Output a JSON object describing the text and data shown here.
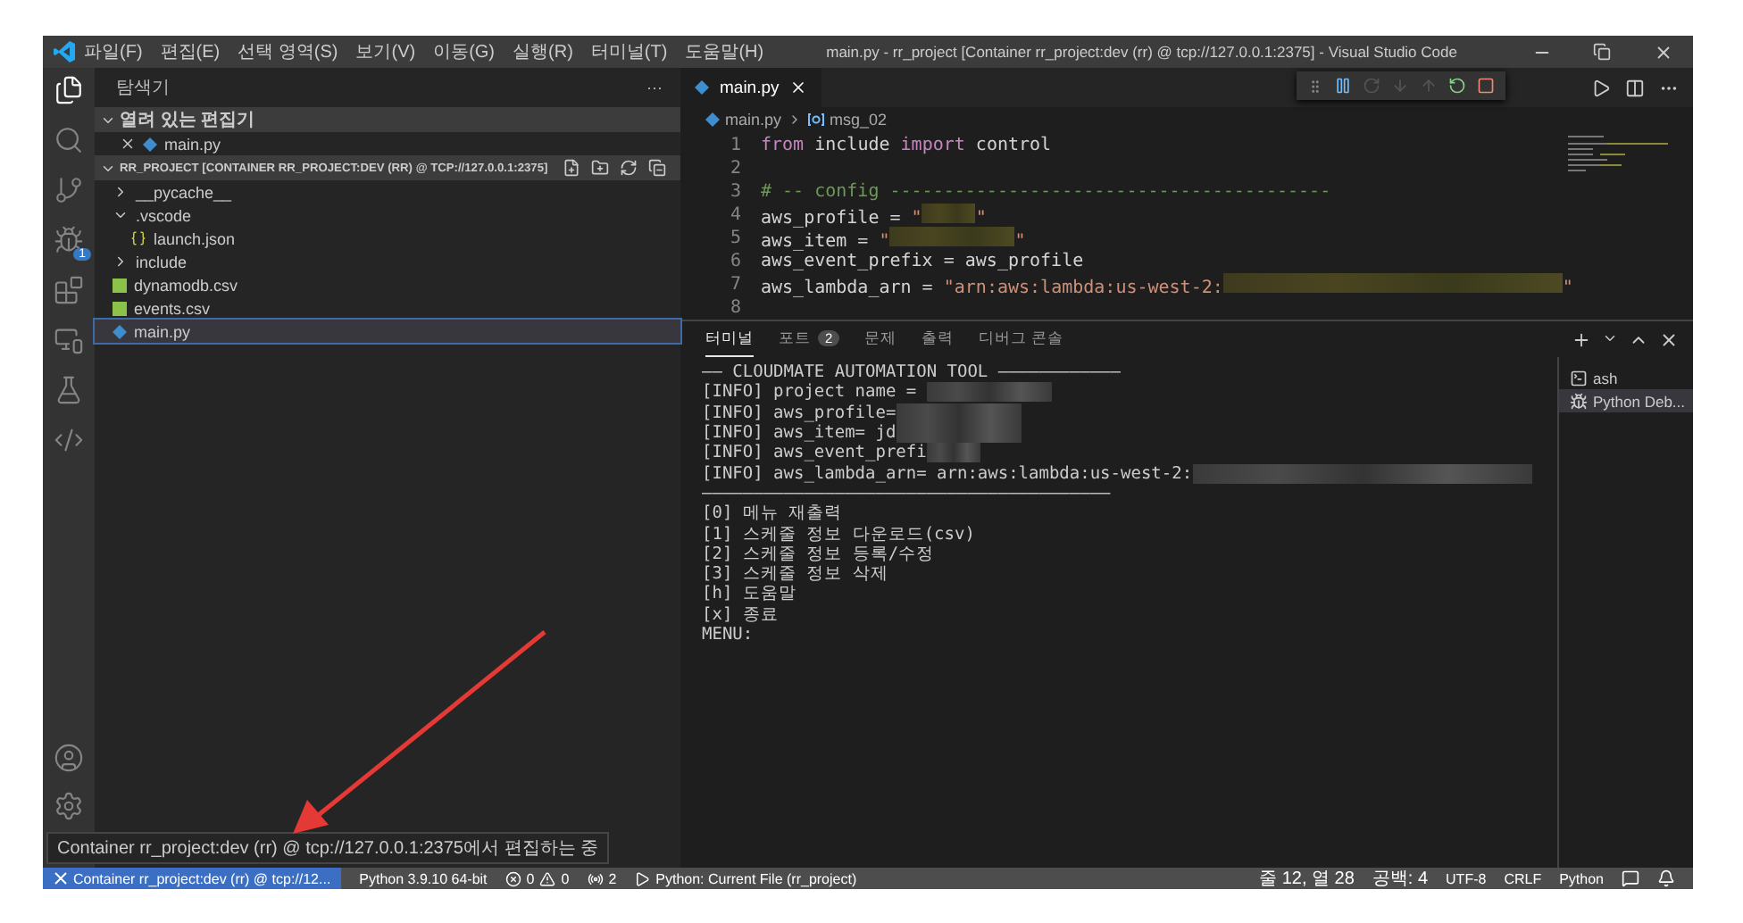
{
  "window": {
    "title": "main.py - rr_project [Container rr_project:dev (rr) @ tcp://127.0.0.1:2375] - Visual Studio Code"
  },
  "menu": [
    "파일(F)",
    "편집(E)",
    "선택 영역(S)",
    "보기(V)",
    "이동(G)",
    "실행(R)",
    "터미널(T)",
    "도움말(H)"
  ],
  "activity_bar": [
    {
      "kind": "files",
      "selected": true
    },
    {
      "kind": "search",
      "selected": false
    },
    {
      "kind": "source-control",
      "selected": false
    },
    {
      "kind": "debug",
      "selected": false,
      "badge": "1"
    },
    {
      "kind": "extensions",
      "selected": false
    },
    {
      "kind": "remote",
      "selected": false
    },
    {
      "kind": "testing",
      "selected": false
    },
    {
      "kind": "python",
      "selected": false
    }
  ],
  "sidebar": {
    "title": "탐색기",
    "more": "···",
    "open_editors": {
      "label": "열려 있는 편집기",
      "expanded": true,
      "items": [
        {
          "name": "main.py",
          "kind": "python"
        }
      ]
    },
    "project": {
      "label": "RR_PROJECT [CONTAINER RR_PROJECT:DEV (RR) @ TCP://127.0.0.1:2375]",
      "expanded": true,
      "items": [
        {
          "name": "__pycache__",
          "kind": "folder",
          "expanded": false,
          "selected": false
        },
        {
          "name": ".vscode",
          "kind": "folder",
          "expanded": true,
          "selected": false,
          "children": [
            {
              "name": "launch.json",
              "kind": "json",
              "selected": false
            }
          ]
        },
        {
          "name": "include",
          "kind": "folder",
          "expanded": false,
          "selected": false
        },
        {
          "name": "dynamodb.csv",
          "kind": "csv",
          "selected": false
        },
        {
          "name": "events.csv",
          "kind": "csv",
          "selected": false
        },
        {
          "name": "main.py",
          "kind": "python",
          "selected": true
        }
      ]
    }
  },
  "editor": {
    "tabs": [
      {
        "label": "main.py",
        "selected": true
      }
    ],
    "breadcrumb": [
      "main.py",
      "msg_02"
    ],
    "lines": [
      {
        "number": "1",
        "segments": [
          {
            "kind": "keyword",
            "text": "from"
          },
          {
            "kind": "plain",
            "text": " include "
          },
          {
            "kind": "keyword",
            "text": "import"
          },
          {
            "kind": "plain",
            "text": " control"
          }
        ]
      },
      {
        "number": "2"
      },
      {
        "number": "3",
        "segments": [
          {
            "kind": "comment",
            "text": "# -- config -----------------------------------------"
          }
        ]
      },
      {
        "number": "4",
        "segments": [
          {
            "kind": "plain",
            "text": "aws_profile = "
          },
          {
            "kind": "string",
            "text": "\""
          },
          {
            "kind": "redactedshort"
          },
          {
            "kind": "string",
            "text": "\""
          }
        ]
      },
      {
        "number": "5",
        "segments": [
          {
            "kind": "plain",
            "text": "aws_item = "
          },
          {
            "kind": "string",
            "text": "\""
          },
          {
            "kind": "redacted"
          },
          {
            "kind": "string",
            "text": "\""
          }
        ]
      },
      {
        "number": "6",
        "segments": [
          {
            "kind": "plain",
            "text": "aws_event_prefix = aws_profile"
          }
        ]
      },
      {
        "number": "7",
        "segments": [
          {
            "kind": "plain",
            "text": "aws_lambda_arn = "
          },
          {
            "kind": "string",
            "text": "\"arn:aws:lambda:us-west-2:"
          },
          {
            "kind": "redactedlong"
          },
          {
            "kind": "string",
            "text": "\""
          }
        ]
      },
      {
        "number": "8"
      }
    ]
  },
  "panel": {
    "tabs": [
      {
        "label": "터미널",
        "selected": true
      },
      {
        "label": "포트",
        "selected": false,
        "badge": "2"
      },
      {
        "label": "문제",
        "selected": false
      },
      {
        "label": "출력",
        "selected": false
      },
      {
        "label": "디버그 콘솔",
        "selected": false
      }
    ],
    "terminal_lines": [
      {
        "segments": [
          {
            "kind": "plain",
            "text": "—— CLOUDMATE AUTOMATION TOOL ————————————"
          }
        ]
      },
      {
        "segments": [
          {
            "kind": "plain",
            "text": "[INFO] project name = "
          },
          {
            "kind": "redacted"
          }
        ]
      },
      {
        "segments": [
          {
            "kind": "plain",
            "text": "[INFO] aws_profile="
          },
          {
            "kind": "redacted"
          }
        ]
      },
      {
        "segments": [
          {
            "kind": "plain",
            "text": "[INFO] aws_item= jd"
          },
          {
            "kind": "redacted"
          }
        ]
      },
      {
        "segments": [
          {
            "kind": "plain",
            "text": "[INFO] aws_event_prefi"
          },
          {
            "kind": "redactedshort"
          }
        ]
      },
      {
        "segments": [
          {
            "kind": "plain",
            "text": "[INFO] aws_lambda_arn= arn:aws:lambda:us-west-2:"
          },
          {
            "kind": "redactedlong"
          }
        ]
      },
      {
        "segments": [
          {
            "kind": "plain",
            "text": "————————————————————————————————————————"
          }
        ]
      },
      {
        "segments": [
          {
            "kind": "plain",
            "text": "[0] 메뉴 재출력"
          }
        ]
      },
      {
        "segments": [
          {
            "kind": "plain",
            "text": "[1] 스케줄 정보 다운로드(csv)"
          }
        ]
      },
      {
        "segments": [
          {
            "kind": "plain",
            "text": "[2] 스케줄 정보 등록/수정"
          }
        ]
      },
      {
        "segments": [
          {
            "kind": "plain",
            "text": "[3] 스케줄 정보 삭제"
          }
        ]
      },
      {
        "segments": [
          {
            "kind": "plain",
            "text": "[h] 도움말"
          }
        ]
      },
      {
        "segments": [
          {
            "kind": "plain",
            "text": "[x] 종료"
          }
        ]
      },
      {
        "segments": [
          {
            "kind": "plain",
            "text": "MENU:"
          }
        ]
      }
    ],
    "terminals": [
      {
        "label": "ash",
        "kind": "shell",
        "selected": false
      },
      {
        "label": "Python Deb...",
        "kind": "debug",
        "selected": true
      }
    ]
  },
  "tooltip": "Container rr_project:dev (rr) @ tcp://127.0.0.1:2375에서 편집하는 중",
  "status_bar": {
    "remote": "Container rr_project:dev (rr) @ tcp://12...",
    "interpreter": "Python 3.9.10 64-bit",
    "errors": "0",
    "warnings": "0",
    "ports": "2",
    "debug": "Python: Current File (rr_project)",
    "right": [
      "줄 12, 열 28",
      "공백: 4",
      "UTF-8",
      "CRLF",
      "Python"
    ]
  }
}
